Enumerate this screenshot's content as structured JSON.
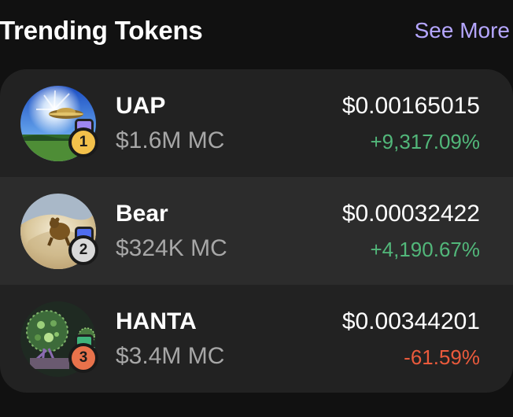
{
  "header": {
    "title": "Trending Tokens",
    "see_more_label": "See More"
  },
  "colors": {
    "accent": "#b5a6ff",
    "positive": "#52b77a",
    "negative": "#ea5a3c",
    "card_bg": "#222222",
    "row_highlight": "#2c2c2c",
    "rank_gold": "#f3c14b",
    "rank_silver": "#d9d9d9",
    "rank_bronze": "#e8724b"
  },
  "tokens": [
    {
      "rank": "1",
      "name": "UAP",
      "market_cap": "$1.6M MC",
      "price": "$0.00165015",
      "change": "+9,317.09%",
      "change_direction": "up",
      "avatar_icon": "ufo-sky-icon",
      "chain_badge_color": "#9d86f0"
    },
    {
      "rank": "2",
      "name": "Bear",
      "market_cap": "$324K MC",
      "price": "$0.00032422",
      "change": "+4,190.67%",
      "change_direction": "up",
      "avatar_icon": "bear-dust-icon",
      "chain_badge_color": "#4f6df0"
    },
    {
      "rank": "3",
      "name": "HANTA",
      "market_cap": "$3.4M MC",
      "price": "$0.00344201",
      "change": "-61.59%",
      "change_direction": "down",
      "avatar_icon": "virus-tree-icon",
      "chain_badge_color": "#3fb37a"
    }
  ]
}
